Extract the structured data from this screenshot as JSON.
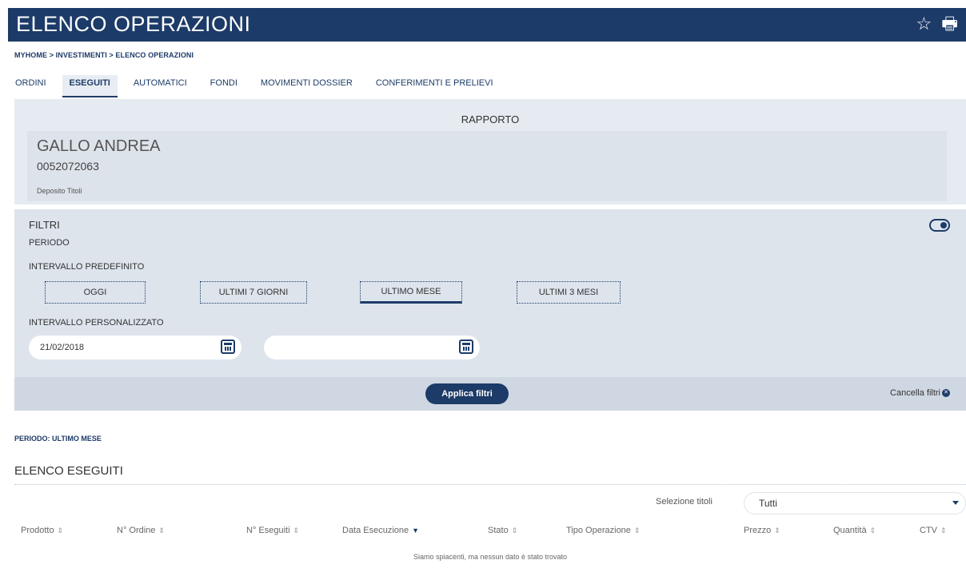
{
  "header": {
    "title": "ELENCO OPERAZIONI",
    "star_icon": "star-icon",
    "print_icon": "print-icon"
  },
  "breadcrumb": "MYHOME > INVESTIMENTI > ELENCO OPERAZIONI",
  "tabs": [
    {
      "label": "ORDINI",
      "active": false
    },
    {
      "label": "ESEGUITI",
      "active": true
    },
    {
      "label": "AUTOMATICI",
      "active": false
    },
    {
      "label": "FONDI",
      "active": false
    },
    {
      "label": "MOVIMENTI DOSSIER",
      "active": false
    },
    {
      "label": "CONFERIMENTI E PRELIEVI",
      "active": false
    }
  ],
  "rapporto": {
    "title": "RAPPORTO",
    "name": "GALLO ANDREA",
    "number": "0052072063",
    "type": "Deposito Titoli"
  },
  "filtri": {
    "title": "FILTRI",
    "periodo_label": "PERIODO",
    "predefinito_label": "INTERVALLO PREDEFINITO",
    "chips": [
      {
        "label": "OGGI",
        "active": false
      },
      {
        "label": "ULTIMI 7 GIORNI",
        "active": false
      },
      {
        "label": "ULTIMO MESE",
        "active": true
      },
      {
        "label": "ULTIMI 3 MESI",
        "active": false
      }
    ],
    "personalizzato_label": "INTERVALLO PERSONALIZZATO",
    "date_from": "21/02/2018",
    "date_to": "",
    "apply_label": "Applica filtri",
    "cancel_label": "Cancella filtri"
  },
  "periodo_summary": "PERIODO: ULTIMO MESE",
  "elenco": {
    "title": "ELENCO ESEGUITI",
    "selezione_label": "Selezione titoli",
    "selezione_value": "Tutti",
    "columns": [
      "Prodotto",
      "N° Ordine",
      "N° Eseguiti",
      "Data Esecuzione",
      "Stato",
      "Tipo Operazione",
      "Prezzo",
      "Quantità",
      "CTV"
    ],
    "empty_message": "Siamo spiacenti, ma nessun dato è stato trovato"
  },
  "colors": {
    "primary": "#1d3b68",
    "panel": "#e6ebf1"
  }
}
